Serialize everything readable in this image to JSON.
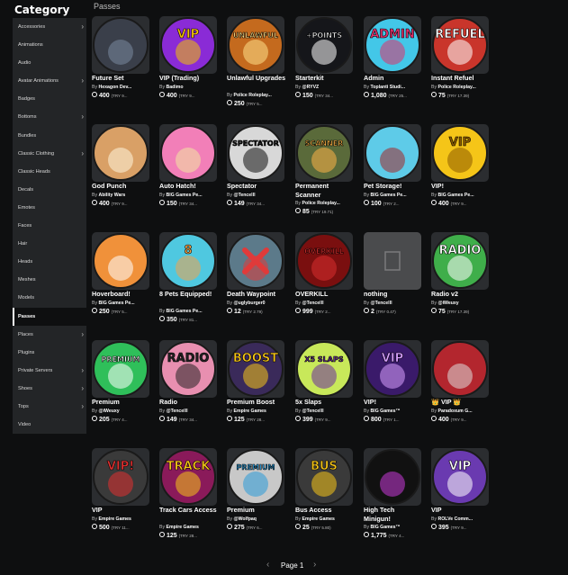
{
  "sidebar": {
    "title": "Category",
    "items": [
      {
        "label": "Accessories",
        "chevron": true
      },
      {
        "label": "Animations",
        "chevron": false
      },
      {
        "label": "Audio",
        "chevron": false
      },
      {
        "label": "Avatar Animations",
        "chevron": true
      },
      {
        "label": "Badges",
        "chevron": false
      },
      {
        "label": "Bottoms",
        "chevron": true
      },
      {
        "label": "Bundles",
        "chevron": false
      },
      {
        "label": "Classic Clothing",
        "chevron": true
      },
      {
        "label": "Classic Heads",
        "chevron": false
      },
      {
        "label": "Decals",
        "chevron": false
      },
      {
        "label": "Emotes",
        "chevron": false
      },
      {
        "label": "Faces",
        "chevron": false
      },
      {
        "label": "Hair",
        "chevron": false
      },
      {
        "label": "Heads",
        "chevron": false
      },
      {
        "label": "Meshes",
        "chevron": false
      },
      {
        "label": "Models",
        "chevron": false
      },
      {
        "label": "Passes",
        "chevron": false,
        "selected": true
      },
      {
        "label": "Places",
        "chevron": true
      },
      {
        "label": "Plugins",
        "chevron": false
      },
      {
        "label": "Private Servers",
        "chevron": true
      },
      {
        "label": "Shoes",
        "chevron": true
      },
      {
        "label": "Tops",
        "chevron": true
      },
      {
        "label": "Video",
        "chevron": false
      }
    ]
  },
  "section_title": "Passes",
  "by_prefix": "By",
  "items": [
    {
      "name": "Future Set",
      "creator": "Hexagon Dev...",
      "price": "400",
      "try": "(TRY 9...",
      "icon": "future-set-icon",
      "bg": "#3a3f4a",
      "fg": "#7a8aa0",
      "text": ""
    },
    {
      "name": "VIP (Trading)",
      "creator": "Badimo",
      "price": "400",
      "try": "(TRY 9...",
      "icon": "vip-trading-icon",
      "bg": "#8a2bd6",
      "fg": "#f2c200",
      "text": "VIP"
    },
    {
      "name": "Unlawful Upgrades",
      "creator": "Police Roleplay...",
      "price": "250",
      "try": "(TRY 5...",
      "icon": "unlawful-upgrades-icon",
      "bg": "#c46a1e",
      "fg": "#ffe08a",
      "text": "UNLAWFUL"
    },
    {
      "name": "Starterkit",
      "creator": "@RYVZ",
      "price": "150",
      "try": "(TRY 34...",
      "icon": "starterkit-icon",
      "bg": "#15161a",
      "fg": "#ffffff",
      "text": "+POINTS"
    },
    {
      "name": "Admin",
      "creator": "Toplanti Studi...",
      "price": "1,080",
      "try": "(TRY 25...",
      "icon": "admin-icon",
      "bg": "#43c7e8",
      "fg": "#e0306a",
      "text": "ADMIN"
    },
    {
      "name": "Instant Refuel",
      "creator": "Police Roleplay...",
      "price": "75",
      "try": "(TRY 17.39)",
      "icon": "instant-refuel-icon",
      "bg": "#c9352b",
      "fg": "#ffffff",
      "text": "REFUEL"
    },
    {
      "name": "God Punch",
      "creator": "Ability Wars",
      "price": "400",
      "try": "(TRY 9...",
      "icon": "god-punch-icon",
      "bg": "#d9a066",
      "fg": "#fff6dc",
      "text": ""
    },
    {
      "name": "Auto Hatch!",
      "creator": "BIG Games Pe...",
      "price": "150",
      "try": "(TRY 34...",
      "icon": "auto-hatch-icon",
      "bg": "#f27fb8",
      "fg": "#f2e7a0",
      "text": ""
    },
    {
      "name": "Spectator",
      "creator": "@Tencelll",
      "price": "149",
      "try": "(TRY 34...",
      "icon": "spectator-icon",
      "bg": "#d8d8d8",
      "fg": "#111111",
      "text": "SPECTATOR"
    },
    {
      "name": "Permanent Scanner",
      "creator": "Police Roleplay...",
      "price": "85",
      "try": "(TRY 19.71)",
      "icon": "permanent-scanner-icon",
      "bg": "#5a6a3a",
      "fg": "#ffb347",
      "text": "SCANNER"
    },
    {
      "name": "Pet Storage!",
      "creator": "BIG Games Pe...",
      "price": "100",
      "try": "(TRY 2...",
      "icon": "pet-storage-icon",
      "bg": "#5ecbe8",
      "fg": "#a42828",
      "text": ""
    },
    {
      "name": "VIP!",
      "creator": "BIG Games Pe...",
      "price": "400",
      "try": "(TRY 9...",
      "icon": "vip-crown-icon",
      "bg": "#f5c518",
      "fg": "#8a5a00",
      "text": "VIP"
    },
    {
      "name": "Hoverboard!",
      "creator": "BIG Games Pe...",
      "price": "250",
      "try": "(TRY 5...",
      "icon": "hoverboard-icon",
      "bg": "#f0913a",
      "fg": "#ffffff",
      "text": ""
    },
    {
      "name": "8 Pets Equipped!",
      "creator": "BIG Games Pe...",
      "price": "350",
      "try": "(TRY 81...",
      "icon": "pets-equipped-icon",
      "bg": "#4fc8e0",
      "fg": "#f4a24a",
      "text": "8"
    },
    {
      "name": "Death Waypoint",
      "creator": "@uglyburger0",
      "price": "12",
      "try": "(TRY 2.79)",
      "icon": "death-waypoint-icon",
      "bg": "#5c7a8a",
      "fg": "#e03a3a",
      "text": ""
    },
    {
      "name": "OVERKILL",
      "creator": "@Tencelll",
      "price": "999",
      "try": "(TRY 2...",
      "icon": "overkill-icon",
      "bg": "#7a0f0f",
      "fg": "#d83030",
      "text": "OVERKILL"
    },
    {
      "name": "nothing",
      "creator": "@Tencelll",
      "price": "2",
      "try": "(TRY 0.47)",
      "icon": "nothing-placeholder-icon",
      "bg": "#4a4b4d",
      "fg": "#7a7b7d",
      "text": ""
    },
    {
      "name": "Radio v2",
      "creator": "@iWeuxy",
      "price": "75",
      "try": "(TRY 17.39)",
      "icon": "radio-v2-icon",
      "bg": "#3fae4a",
      "fg": "#ffffff",
      "text": "RADIO"
    },
    {
      "name": "Premium",
      "creator": "@iWeuxy",
      "price": "205",
      "try": "(TRY 4...",
      "icon": "premium-avatar-icon",
      "bg": "#2fbf5a",
      "fg": "#ffffff",
      "text": "PREMIUM"
    },
    {
      "name": "Radio",
      "creator": "@Tencelll",
      "price": "149",
      "try": "(TRY 34...",
      "icon": "radio-icon",
      "bg": "#e88fb0",
      "fg": "#222222",
      "text": "RADIO"
    },
    {
      "name": "Premium Boost",
      "creator": "Empire Games",
      "price": "125",
      "try": "(TRY 28...",
      "icon": "premium-boost-icon",
      "bg": "#3a2a5a",
      "fg": "#f5c518",
      "text": "BOOST"
    },
    {
      "name": "5x Slaps",
      "creator": "@Tencelll",
      "price": "399",
      "try": "(TRY 9...",
      "icon": "slaps-icon",
      "bg": "#c8e85a",
      "fg": "#6a2aa0",
      "text": "X5 SLAPS"
    },
    {
      "name": "VIP!",
      "creator": "BIG Games™",
      "price": "800",
      "try": "(TRY 1...",
      "icon": "vip-purple-icon",
      "bg": "#3a1a6a",
      "fg": "#d8a0ff",
      "text": "VIP"
    },
    {
      "name": "👑 VIP 👑",
      "creator": "Paradoxum G...",
      "price": "400",
      "try": "(TRY 9...",
      "icon": "vip-card-icon",
      "bg": "#b3262e",
      "fg": "#dddddd",
      "text": ""
    },
    {
      "name": "VIP",
      "creator": "Empire Games",
      "price": "500",
      "try": "(TRY 11...",
      "icon": "vip-badge-icon",
      "bg": "#3a3a3a",
      "fg": "#e03030",
      "text": "VIP!"
    },
    {
      "name": "Track Cars Access",
      "creator": "Empire Games",
      "price": "125",
      "try": "(TRY 28...",
      "icon": "track-cars-icon",
      "bg": "#8a1a5a",
      "fg": "#f5c518",
      "text": "TRACK"
    },
    {
      "name": "Premium",
      "creator": "@Wolfpaq",
      "price": "275",
      "try": "(TRY 6...",
      "icon": "premium-star-icon",
      "bg": "#c8c8c8",
      "fg": "#2a9ad8",
      "text": "PREMIUM"
    },
    {
      "name": "Bus Access",
      "creator": "Empire Games",
      "price": "25",
      "try": "(TRY 5.80)",
      "icon": "bus-access-icon",
      "bg": "#3a3a3a",
      "fg": "#f5c518",
      "text": "BUS"
    },
    {
      "name": "High Tech Minigun!",
      "creator": "BIG Games™",
      "price": "1,775",
      "try": "(TRY 4...",
      "icon": "minigun-icon",
      "bg": "#111111",
      "fg": "#c83ad8",
      "text": ""
    },
    {
      "name": "VIP",
      "creator": "ROLVe Comm...",
      "price": "395",
      "try": "(TRY 9...",
      "icon": "vip-rolve-icon",
      "bg": "#6a3ab0",
      "fg": "#ffffff",
      "text": "VIP"
    }
  ],
  "pagination": {
    "label": "Page 1",
    "prev": "‹",
    "next": "›"
  }
}
